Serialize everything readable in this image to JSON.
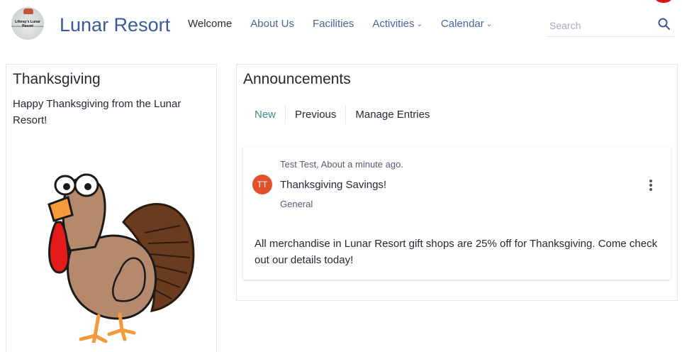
{
  "header": {
    "logo": {
      "text": "Liferay's Lunar Resort",
      "tagline": "Everything's better with no gravity"
    },
    "site_name": "Lunar Resort",
    "nav": [
      {
        "label": "Welcome",
        "active": true
      },
      {
        "label": "About Us"
      },
      {
        "label": "Facilities"
      },
      {
        "label": "Activities",
        "has_dropdown": true
      },
      {
        "label": "Calendar",
        "has_dropdown": true
      }
    ],
    "search": {
      "placeholder": "Search",
      "value": "",
      "icon": "search-icon"
    }
  },
  "left_card": {
    "title": "Thanksgiving",
    "message": "Happy Thanksgiving from the Lunar Resort!",
    "image": "turkey-illustration"
  },
  "right_card": {
    "title": "Announcements",
    "tabs": [
      {
        "label": "New",
        "active": true
      },
      {
        "label": "Previous"
      },
      {
        "label": "Manage Entries"
      }
    ],
    "entry": {
      "avatar_initials": "TT",
      "meta": "Test Test, About a minute ago.",
      "title": "Thanksgiving Savings!",
      "category": "General",
      "body": "All merchandise in Lunar Resort gift shops are 25% off for Thanksgiving. Come check out our details today!",
      "menu_icon": "more-vertical-icon"
    }
  },
  "colors": {
    "brand": "#3a5a99",
    "tab_active": "#3a8a8f",
    "avatar": "#e34f2b",
    "border": "#e7e7ed"
  }
}
